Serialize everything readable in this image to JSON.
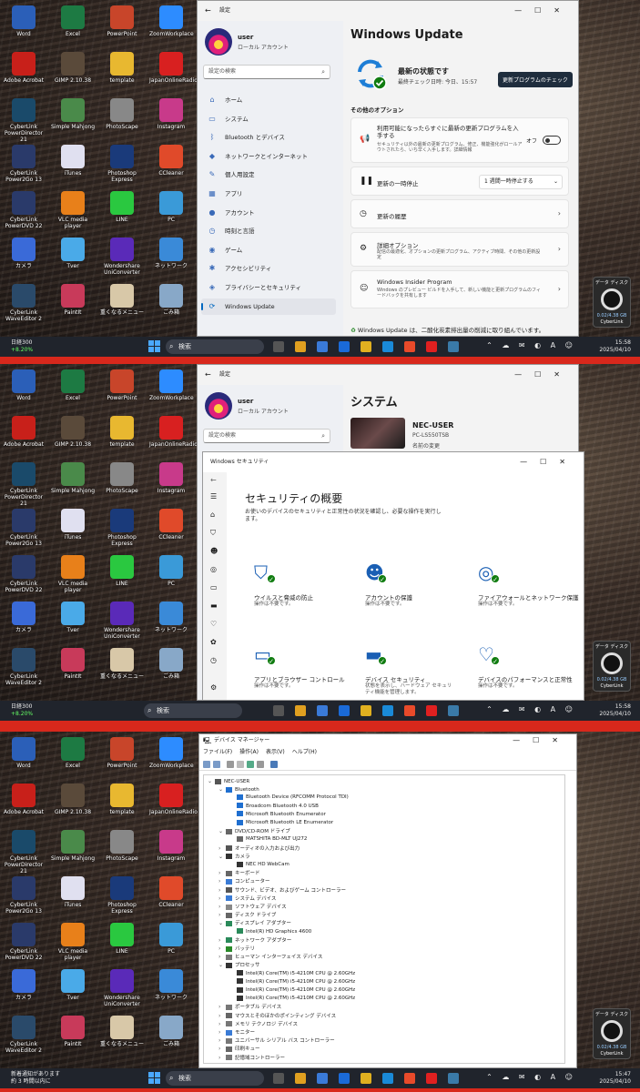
{
  "desktop_icons": [
    [
      "Word",
      "Excel",
      "PowerPoint",
      "ZoomWorkplace"
    ],
    [
      "Adobe Acrobat",
      "GIMP 2.10.38",
      "template",
      "JapanOnlineRadio"
    ],
    [
      "CyberLink PowerDirector 21",
      "Simple Mahjong",
      "PhotoScape",
      "Instagram"
    ],
    [
      "CyberLink Power2Go 13",
      "iTunes",
      "Photoshop Express",
      "CCleaner"
    ],
    [
      "CyberLink PowerDVD 22",
      "VLC media player",
      "LINE",
      "PC"
    ],
    [
      "カメラ",
      "Tver",
      "Wondershare UniConverter",
      "ネットワーク"
    ],
    [
      "CyberLink WaveEditor 2",
      "PaintIt",
      "重くなるメニュー",
      "ごみ箱"
    ]
  ],
  "taskbar": {
    "search_label": "検索",
    "news_1": "日経300",
    "news_1b": "+8.20%",
    "news_3": "新着通知があります",
    "news_3b": "約 3 時間以内に",
    "time_1": "15:58",
    "date_1": "2025/04/10",
    "time_2": "15:58",
    "date_2": "2025/04/10",
    "time_3": "15:47",
    "date_3": "2025/04/10",
    "tray": "⌃ ☁ ✉ ◐ A ☺"
  },
  "gadget": {
    "title": "データ ディスク",
    "value": "0.02/4.38 GB",
    "logo": "CyberLink"
  },
  "settings": {
    "title": "設定",
    "user": "user",
    "account_type": "ローカル アカウント",
    "search_placeholder": "設定の検索",
    "nav": [
      {
        "icon": "⌂",
        "label": "ホーム"
      },
      {
        "icon": "▭",
        "label": "システム"
      },
      {
        "icon": "ᛒ",
        "label": "Bluetooth とデバイス"
      },
      {
        "icon": "◆",
        "label": "ネットワークとインターネット"
      },
      {
        "icon": "✎",
        "label": "個人用設定"
      },
      {
        "icon": "▦",
        "label": "アプリ"
      },
      {
        "icon": "●",
        "label": "アカウント"
      },
      {
        "icon": "◷",
        "label": "時刻と言語"
      },
      {
        "icon": "◉",
        "label": "ゲーム"
      },
      {
        "icon": "✱",
        "label": "アクセシビリティ"
      },
      {
        "icon": "◈",
        "label": "プライバシーとセキュリティ"
      },
      {
        "icon": "⟳",
        "label": "Windows Update"
      }
    ],
    "wu": {
      "heading": "Windows Update",
      "status": "最新の状態です",
      "last_check": "最終チェック日時: 今日、15:57",
      "check_button": "更新プログラムのチェック",
      "other_options": "その他のオプション",
      "opt1_title": "利用可能になったらすぐに最新の更新プログラムを入手する",
      "opt1_sub": "セキュリティ以外の最新の更新プログラム、修正、機能強化がロールアウトされたら、いち早く入手します。詳細情報",
      "opt1_toggle": "オフ",
      "pause_title": "更新の一時停止",
      "pause_value": "1 週間一時停止する",
      "history": "更新の履歴",
      "advanced_title": "詳細オプション",
      "advanced_sub": "配信の最適化、オプションの更新プログラム、アクティブ時間、その他の更新設定",
      "insider_title": "Windows Insider Program",
      "insider_sub": "Windows のプレビュー ビルドを入手して、新しい機能と更新プログラムのフィードバックを共有します",
      "footer": "Windows Update は、二酸化炭素排出量の削減に取り組んでいます。"
    },
    "system": {
      "heading": "システム",
      "device": "NEC-USER",
      "model": "PC-LS550TSB",
      "rename": "名前の変更"
    }
  },
  "security": {
    "title": "Windows セキュリティ",
    "heading": "セキュリティの概要",
    "subtitle": "お使いのデバイスのセキュリティと正常性の状況を確認し、必要な操作を実行します。",
    "tiles": [
      {
        "title": "ウイルスと脅威の防止",
        "sub": "操作は不要です。"
      },
      {
        "title": "アカウントの保護",
        "sub": "操作は不要です。"
      },
      {
        "title": "ファイアウォールとネットワーク保護",
        "sub": "操作は不要です。"
      },
      {
        "title": "アプリとブラウザー コントロール",
        "sub": "操作は不要です。"
      },
      {
        "title": "デバイス セキュリティ",
        "sub": "状態を表示し、ハードウェア セキュリティ機能を管理します。"
      },
      {
        "title": "デバイスのパフォーマンスと正常性",
        "sub": "操作は不要です。"
      }
    ]
  },
  "devmgr": {
    "title": "デバイス マネージャー",
    "menu": [
      "ファイル(F)",
      "操作(A)",
      "表示(V)",
      "ヘルプ(H)"
    ],
    "rows": [
      {
        "d": 0,
        "ex": "⌄",
        "t": "NEC-USER",
        "c": "#555"
      },
      {
        "d": 1,
        "ex": "⌄",
        "t": "Bluetooth",
        "c": "#1f6fd0"
      },
      {
        "d": 2,
        "ex": "",
        "t": "Bluetooth Device (RFCOMM Protocol TDI)",
        "c": "#1f6fd0"
      },
      {
        "d": 2,
        "ex": "",
        "t": "Broadcom Bluetooth 4.0 USB",
        "c": "#1f6fd0"
      },
      {
        "d": 2,
        "ex": "",
        "t": "Microsoft Bluetooth Enumerator",
        "c": "#1f6fd0"
      },
      {
        "d": 2,
        "ex": "",
        "t": "Microsoft Bluetooth LE Enumerator",
        "c": "#1f6fd0"
      },
      {
        "d": 1,
        "ex": "⌄",
        "t": "DVD/CD-ROM ドライブ",
        "c": "#666"
      },
      {
        "d": 2,
        "ex": "",
        "t": "MATSHITA BD-MLT UJ272",
        "c": "#666"
      },
      {
        "d": 1,
        "ex": "›",
        "t": "オーディオの入力および出力",
        "c": "#555"
      },
      {
        "d": 1,
        "ex": "⌄",
        "t": "カメラ",
        "c": "#333"
      },
      {
        "d": 2,
        "ex": "",
        "t": "NEC HD WebCam",
        "c": "#333"
      },
      {
        "d": 1,
        "ex": "›",
        "t": "キーボード",
        "c": "#666"
      },
      {
        "d": 1,
        "ex": "›",
        "t": "コンピューター",
        "c": "#3a7bd5"
      },
      {
        "d": 1,
        "ex": "›",
        "t": "サウンド、ビデオ、およびゲーム コントローラー",
        "c": "#555"
      },
      {
        "d": 1,
        "ex": "›",
        "t": "システム デバイス",
        "c": "#3a7bd5"
      },
      {
        "d": 1,
        "ex": "›",
        "t": "ソフトウェア デバイス",
        "c": "#888"
      },
      {
        "d": 1,
        "ex": "›",
        "t": "ディスク ドライブ",
        "c": "#666"
      },
      {
        "d": 1,
        "ex": "⌄",
        "t": "ディスプレイ アダプター",
        "c": "#2a8a5a"
      },
      {
        "d": 2,
        "ex": "",
        "t": "Intel(R) HD Graphics 4600",
        "c": "#2a8a5a"
      },
      {
        "d": 1,
        "ex": "›",
        "t": "ネットワーク アダプター",
        "c": "#2a8a5a"
      },
      {
        "d": 1,
        "ex": "›",
        "t": "バッテリ",
        "c": "#2a8a2a"
      },
      {
        "d": 1,
        "ex": "›",
        "t": "ヒューマン インターフェイス デバイス",
        "c": "#777"
      },
      {
        "d": 1,
        "ex": "⌄",
        "t": "プロセッサ",
        "c": "#333"
      },
      {
        "d": 2,
        "ex": "",
        "t": "Intel(R) Core(TM) i5-4210M CPU @ 2.60GHz",
        "c": "#333"
      },
      {
        "d": 2,
        "ex": "",
        "t": "Intel(R) Core(TM) i5-4210M CPU @ 2.60GHz",
        "c": "#333"
      },
      {
        "d": 2,
        "ex": "",
        "t": "Intel(R) Core(TM) i5-4210M CPU @ 2.60GHz",
        "c": "#333"
      },
      {
        "d": 2,
        "ex": "",
        "t": "Intel(R) Core(TM) i5-4210M CPU @ 2.60GHz",
        "c": "#333"
      },
      {
        "d": 1,
        "ex": "›",
        "t": "ポータブル デバイス",
        "c": "#777"
      },
      {
        "d": 1,
        "ex": "›",
        "t": "マウスとそのほかのポインティング デバイス",
        "c": "#666"
      },
      {
        "d": 1,
        "ex": "›",
        "t": "メモリ テクノロジ デバイス",
        "c": "#777"
      },
      {
        "d": 1,
        "ex": "›",
        "t": "モニター",
        "c": "#3a7bd5"
      },
      {
        "d": 1,
        "ex": "›",
        "t": "ユニバーサル シリアル バス コントローラー",
        "c": "#777"
      },
      {
        "d": 1,
        "ex": "›",
        "t": "印刷キュー",
        "c": "#666"
      },
      {
        "d": 1,
        "ex": "›",
        "t": "記憶域コントローラー",
        "c": "#777"
      }
    ]
  },
  "colors": {
    "accent": "#0067c0",
    "taskbar": "#20242c",
    "separator": "#d8281c",
    "ok_green": "#107c10"
  }
}
